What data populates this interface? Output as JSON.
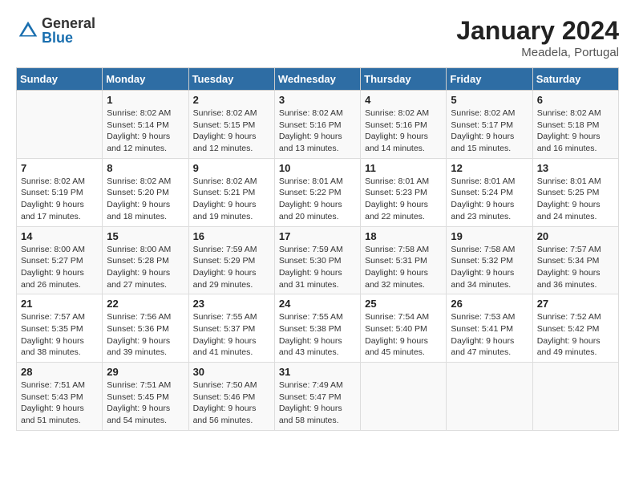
{
  "header": {
    "logo_general": "General",
    "logo_blue": "Blue",
    "month_year": "January 2024",
    "location": "Meadela, Portugal"
  },
  "days_of_week": [
    "Sunday",
    "Monday",
    "Tuesday",
    "Wednesday",
    "Thursday",
    "Friday",
    "Saturday"
  ],
  "weeks": [
    [
      {
        "num": "",
        "info": ""
      },
      {
        "num": "1",
        "info": "Sunrise: 8:02 AM\nSunset: 5:14 PM\nDaylight: 9 hours\nand 12 minutes."
      },
      {
        "num": "2",
        "info": "Sunrise: 8:02 AM\nSunset: 5:15 PM\nDaylight: 9 hours\nand 12 minutes."
      },
      {
        "num": "3",
        "info": "Sunrise: 8:02 AM\nSunset: 5:16 PM\nDaylight: 9 hours\nand 13 minutes."
      },
      {
        "num": "4",
        "info": "Sunrise: 8:02 AM\nSunset: 5:16 PM\nDaylight: 9 hours\nand 14 minutes."
      },
      {
        "num": "5",
        "info": "Sunrise: 8:02 AM\nSunset: 5:17 PM\nDaylight: 9 hours\nand 15 minutes."
      },
      {
        "num": "6",
        "info": "Sunrise: 8:02 AM\nSunset: 5:18 PM\nDaylight: 9 hours\nand 16 minutes."
      }
    ],
    [
      {
        "num": "7",
        "info": "Sunrise: 8:02 AM\nSunset: 5:19 PM\nDaylight: 9 hours\nand 17 minutes."
      },
      {
        "num": "8",
        "info": "Sunrise: 8:02 AM\nSunset: 5:20 PM\nDaylight: 9 hours\nand 18 minutes."
      },
      {
        "num": "9",
        "info": "Sunrise: 8:02 AM\nSunset: 5:21 PM\nDaylight: 9 hours\nand 19 minutes."
      },
      {
        "num": "10",
        "info": "Sunrise: 8:01 AM\nSunset: 5:22 PM\nDaylight: 9 hours\nand 20 minutes."
      },
      {
        "num": "11",
        "info": "Sunrise: 8:01 AM\nSunset: 5:23 PM\nDaylight: 9 hours\nand 22 minutes."
      },
      {
        "num": "12",
        "info": "Sunrise: 8:01 AM\nSunset: 5:24 PM\nDaylight: 9 hours\nand 23 minutes."
      },
      {
        "num": "13",
        "info": "Sunrise: 8:01 AM\nSunset: 5:25 PM\nDaylight: 9 hours\nand 24 minutes."
      }
    ],
    [
      {
        "num": "14",
        "info": "Sunrise: 8:00 AM\nSunset: 5:27 PM\nDaylight: 9 hours\nand 26 minutes."
      },
      {
        "num": "15",
        "info": "Sunrise: 8:00 AM\nSunset: 5:28 PM\nDaylight: 9 hours\nand 27 minutes."
      },
      {
        "num": "16",
        "info": "Sunrise: 7:59 AM\nSunset: 5:29 PM\nDaylight: 9 hours\nand 29 minutes."
      },
      {
        "num": "17",
        "info": "Sunrise: 7:59 AM\nSunset: 5:30 PM\nDaylight: 9 hours\nand 31 minutes."
      },
      {
        "num": "18",
        "info": "Sunrise: 7:58 AM\nSunset: 5:31 PM\nDaylight: 9 hours\nand 32 minutes."
      },
      {
        "num": "19",
        "info": "Sunrise: 7:58 AM\nSunset: 5:32 PM\nDaylight: 9 hours\nand 34 minutes."
      },
      {
        "num": "20",
        "info": "Sunrise: 7:57 AM\nSunset: 5:34 PM\nDaylight: 9 hours\nand 36 minutes."
      }
    ],
    [
      {
        "num": "21",
        "info": "Sunrise: 7:57 AM\nSunset: 5:35 PM\nDaylight: 9 hours\nand 38 minutes."
      },
      {
        "num": "22",
        "info": "Sunrise: 7:56 AM\nSunset: 5:36 PM\nDaylight: 9 hours\nand 39 minutes."
      },
      {
        "num": "23",
        "info": "Sunrise: 7:55 AM\nSunset: 5:37 PM\nDaylight: 9 hours\nand 41 minutes."
      },
      {
        "num": "24",
        "info": "Sunrise: 7:55 AM\nSunset: 5:38 PM\nDaylight: 9 hours\nand 43 minutes."
      },
      {
        "num": "25",
        "info": "Sunrise: 7:54 AM\nSunset: 5:40 PM\nDaylight: 9 hours\nand 45 minutes."
      },
      {
        "num": "26",
        "info": "Sunrise: 7:53 AM\nSunset: 5:41 PM\nDaylight: 9 hours\nand 47 minutes."
      },
      {
        "num": "27",
        "info": "Sunrise: 7:52 AM\nSunset: 5:42 PM\nDaylight: 9 hours\nand 49 minutes."
      }
    ],
    [
      {
        "num": "28",
        "info": "Sunrise: 7:51 AM\nSunset: 5:43 PM\nDaylight: 9 hours\nand 51 minutes."
      },
      {
        "num": "29",
        "info": "Sunrise: 7:51 AM\nSunset: 5:45 PM\nDaylight: 9 hours\nand 54 minutes."
      },
      {
        "num": "30",
        "info": "Sunrise: 7:50 AM\nSunset: 5:46 PM\nDaylight: 9 hours\nand 56 minutes."
      },
      {
        "num": "31",
        "info": "Sunrise: 7:49 AM\nSunset: 5:47 PM\nDaylight: 9 hours\nand 58 minutes."
      },
      {
        "num": "",
        "info": ""
      },
      {
        "num": "",
        "info": ""
      },
      {
        "num": "",
        "info": ""
      }
    ]
  ]
}
